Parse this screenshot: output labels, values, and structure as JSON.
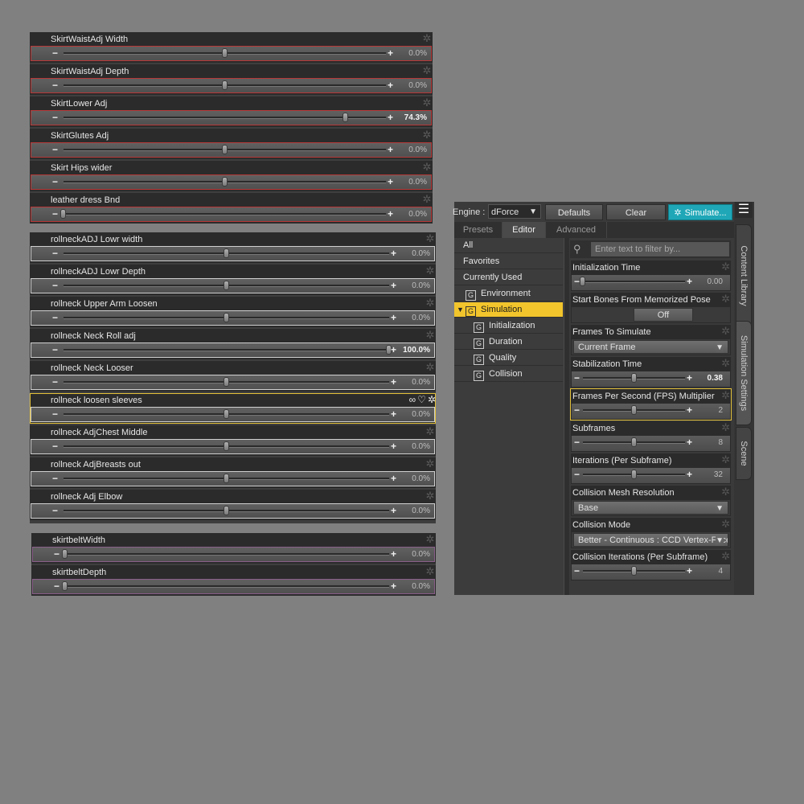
{
  "panel1": [
    {
      "name": "SkirtWaistAdj Width",
      "value": "0.0%",
      "pos": 0.5
    },
    {
      "name": "SkirtWaistAdj Depth",
      "value": "0.0%",
      "pos": 0.5
    },
    {
      "name": "SkirtLower Adj",
      "value": "74.3%",
      "pos": 0.876,
      "strong": true
    },
    {
      "name": "SkirtGlutes Adj",
      "value": "0.0%",
      "pos": 0.5
    },
    {
      "name": "Skirt Hips wider",
      "value": "0.0%",
      "pos": 0.5
    },
    {
      "name": "leather dress Bnd",
      "value": "0.0%",
      "pos": 0.0
    }
  ],
  "panel2": [
    {
      "name": "rollneckADJ Lowr width",
      "value": "0.0%",
      "pos": 0.5
    },
    {
      "name": "rollneckADJ Lowr Depth",
      "value": "0.0%",
      "pos": 0.5
    },
    {
      "name": "rollneck Upper Arm Loosen",
      "value": "0.0%",
      "pos": 0.5
    },
    {
      "name": "rollneck Neck Roll adj",
      "value": "100.0%",
      "pos": 1.0,
      "strong": true
    },
    {
      "name": "rollneck Neck Looser",
      "value": "0.0%",
      "pos": 0.5
    },
    {
      "name": "rollneck loosen sleeves",
      "value": "0.0%",
      "pos": 0.5,
      "selected": true
    },
    {
      "name": "rollneck AdjChest Middle",
      "value": "0.0%",
      "pos": 0.5
    },
    {
      "name": "rollneck AdjBreasts out",
      "value": "0.0%",
      "pos": 0.5
    },
    {
      "name": "rollneck Adj Elbow",
      "value": "0.0%",
      "pos": 0.5
    }
  ],
  "panel3": [
    {
      "name": "skirtbeltWidth",
      "value": "0.0%",
      "pos": 0.0
    },
    {
      "name": "skirtbeltDepth",
      "value": "0.0%",
      "pos": 0.0
    }
  ],
  "sim": {
    "engine_label": "Engine :",
    "engine_value": "dForce",
    "defaults_label": "Defaults",
    "clear_label": "Clear",
    "simulate_label": "Simulate...",
    "tabs": [
      "Presets",
      "Editor",
      "Advanced"
    ],
    "active_tab": "Editor",
    "side_tabs": [
      "Content Library",
      "Simulation Settings",
      "Scene"
    ],
    "filter_placeholder": "Enter text to filter by...",
    "tree": [
      {
        "label": "All",
        "indent": 0
      },
      {
        "label": "Favorites",
        "indent": 0
      },
      {
        "label": "Currently Used",
        "indent": 0
      },
      {
        "label": "Environment",
        "indent": 1,
        "icon": true
      },
      {
        "label": "Simulation",
        "indent": 1,
        "icon": true,
        "selected": true,
        "expanded": true
      },
      {
        "label": "Initialization",
        "indent": 2,
        "icon": true
      },
      {
        "label": "Duration",
        "indent": 2,
        "icon": true
      },
      {
        "label": "Quality",
        "indent": 2,
        "icon": true
      },
      {
        "label": "Collision",
        "indent": 2,
        "icon": true
      }
    ],
    "settings": [
      {
        "kind": "slider",
        "label": "Initialization Time",
        "value": "0.00",
        "pos": 0.0
      },
      {
        "kind": "toggle",
        "label": "Start Bones From Memorized Pose",
        "value": "Off"
      },
      {
        "kind": "dropdown",
        "label": "Frames To Simulate",
        "value": "Current Frame"
      },
      {
        "kind": "slider",
        "label": "Stabilization Time",
        "value": "0.38",
        "pos": 0.5,
        "strong": true
      },
      {
        "kind": "slider",
        "label": "Frames Per Second (FPS) Multiplier",
        "value": "2",
        "pos": 0.5,
        "selected": true
      },
      {
        "kind": "slider",
        "label": "Subframes",
        "value": "8",
        "pos": 0.5
      },
      {
        "kind": "slider",
        "label": "Iterations (Per Subframe)",
        "value": "32",
        "pos": 0.5
      },
      {
        "kind": "dropdown",
        "label": "Collision Mesh Resolution",
        "value": "Base"
      },
      {
        "kind": "dropdown",
        "label": "Collision Mode",
        "value": "Better - Continuous : CCD Vertex-Face"
      },
      {
        "kind": "slider",
        "label": "Collision Iterations (Per Subframe)",
        "value": "4",
        "pos": 0.5
      }
    ]
  }
}
